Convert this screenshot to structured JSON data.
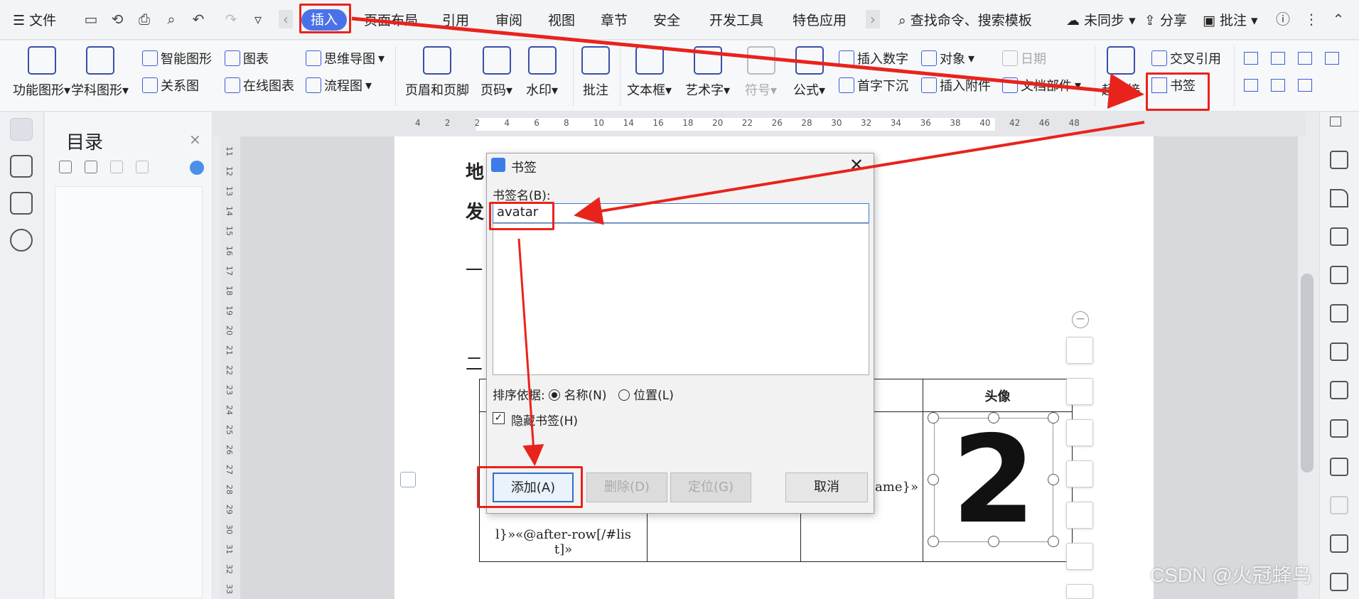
{
  "menubar": {
    "file": "文件",
    "tabs": [
      "插入",
      "页面布局",
      "引用",
      "审阅",
      "视图",
      "章节",
      "安全",
      "开发工具",
      "特色应用"
    ],
    "search": "查找命令、搜索模板",
    "sync": "未同步",
    "share": "分享",
    "comment": "批注"
  },
  "ribbon": {
    "func_shape": "功能图形",
    "subject_shape": "学科图形",
    "smart_shape": "智能图形",
    "chart": "图表",
    "relation": "关系图",
    "online_chart": "在线图表",
    "mindmap": "思维导图",
    "flowchart": "流程图",
    "header_footer": "页眉和页脚",
    "page_num": "页码",
    "watermark": "水印",
    "annotate": "批注",
    "textbox": "文本框",
    "wordart": "艺术字",
    "symbol": "符号",
    "formula": "公式",
    "insert_number": "插入数字",
    "object": "对象",
    "date": "日期",
    "drop_cap": "首字下沉",
    "attachment": "插入附件",
    "doc_parts": "文档部件",
    "hyperlink": "超链接",
    "cross_ref": "交叉引用",
    "bookmark": "书签"
  },
  "toc": {
    "title": "目录"
  },
  "ruler_h": [
    "4",
    "2",
    "2",
    "4",
    "6",
    "8",
    "10",
    "14",
    "16",
    "18",
    "20",
    "22",
    "26",
    "28",
    "30",
    "32",
    "34",
    "36",
    "38",
    "40",
    "42",
    "46",
    "48"
  ],
  "ruler_v": [
    "11",
    "12",
    "13",
    "14",
    "15",
    "16",
    "17",
    "18",
    "19",
    "20",
    "21",
    "22",
    "23",
    "24",
    "25",
    "26",
    "27",
    "28",
    "29",
    "30",
    "31",
    "32",
    "33"
  ],
  "doc": {
    "line1": "地",
    "line2": "发",
    "line3": "一",
    "line4": "二",
    "col_avatar": "头像",
    "cell_a": "l}»«@after-row[/#lis",
    "cell_a2": "t]»",
    "cell_name": "ame}»",
    "signature": "2"
  },
  "dialog": {
    "title": "书签",
    "name_label": "书签名(B):",
    "name_value": "avatar",
    "sort_label": "排序依据:",
    "sort_name": "名称(N)",
    "sort_position": "位置(L)",
    "hidden": "隐藏书签(H)",
    "add": "添加(A)",
    "delete": "删除(D)",
    "goto": "定位(G)",
    "cancel": "取消"
  },
  "watermark": "CSDN @火冠蜂鸟",
  "colors": {
    "accent": "#4a72e8",
    "annotation": "#e8231c"
  }
}
